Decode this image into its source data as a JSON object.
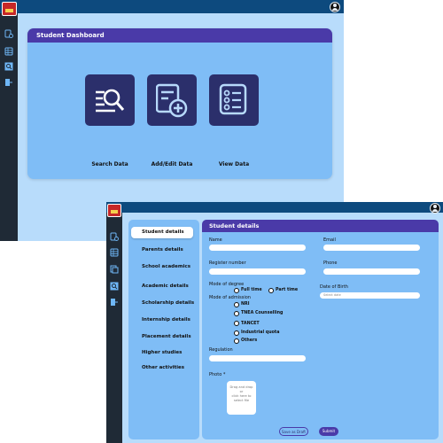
{
  "dashboard": {
    "header_title": "Student Dashboard",
    "tiles": [
      {
        "label": "Search Data",
        "icon": "search-data-icon"
      },
      {
        "label": "Add/Edit Data",
        "icon": "add-edit-data-icon"
      },
      {
        "label": "View Data",
        "icon": "view-data-icon"
      }
    ],
    "sidebar_icons": [
      "document-settings-icon",
      "table-icon",
      "search-person-icon",
      "exit-icon"
    ]
  },
  "details": {
    "header_title": "Student details",
    "nav_items": [
      "Student details",
      "Parents details",
      "School academics",
      "Academic details",
      "Scholarship details",
      "Internship details",
      "Placement details",
      "Higher studies",
      "Other activities"
    ],
    "sidebar_icons": [
      "document-settings-icon",
      "table-icon",
      "copy-icon",
      "search-person-icon",
      "exit-icon"
    ],
    "form": {
      "name_label": "Name",
      "email_label": "Email",
      "register_label": "Register number",
      "phone_label": "Phone",
      "mode_degree_label": "Mode of degree",
      "degree_options": [
        "Full time",
        "Part time"
      ],
      "dob_label": "Date of Birth",
      "dob_placeholder": "Select date",
      "mode_admission_label": "Mode of admission",
      "admission_options": [
        "NRI",
        "TNEA Counselling",
        "TANCET",
        "Industrial quota",
        "Others"
      ],
      "regulation_label": "Regulation",
      "photo_label": "Photo *",
      "photo_hint_1": "Drag and drop",
      "photo_hint_2": "or",
      "photo_hint_3": "click here to",
      "photo_hint_4": "select file",
      "save_draft": "Save as Draft",
      "submit": "Submit"
    }
  },
  "colors": {
    "topbar": "#0d4a7e",
    "sidebar": "#1f2a36",
    "header": "#4a3aa8",
    "panel": "#7fbdf6",
    "background": "#b8dcfb",
    "tile": "#2b2f6b"
  }
}
